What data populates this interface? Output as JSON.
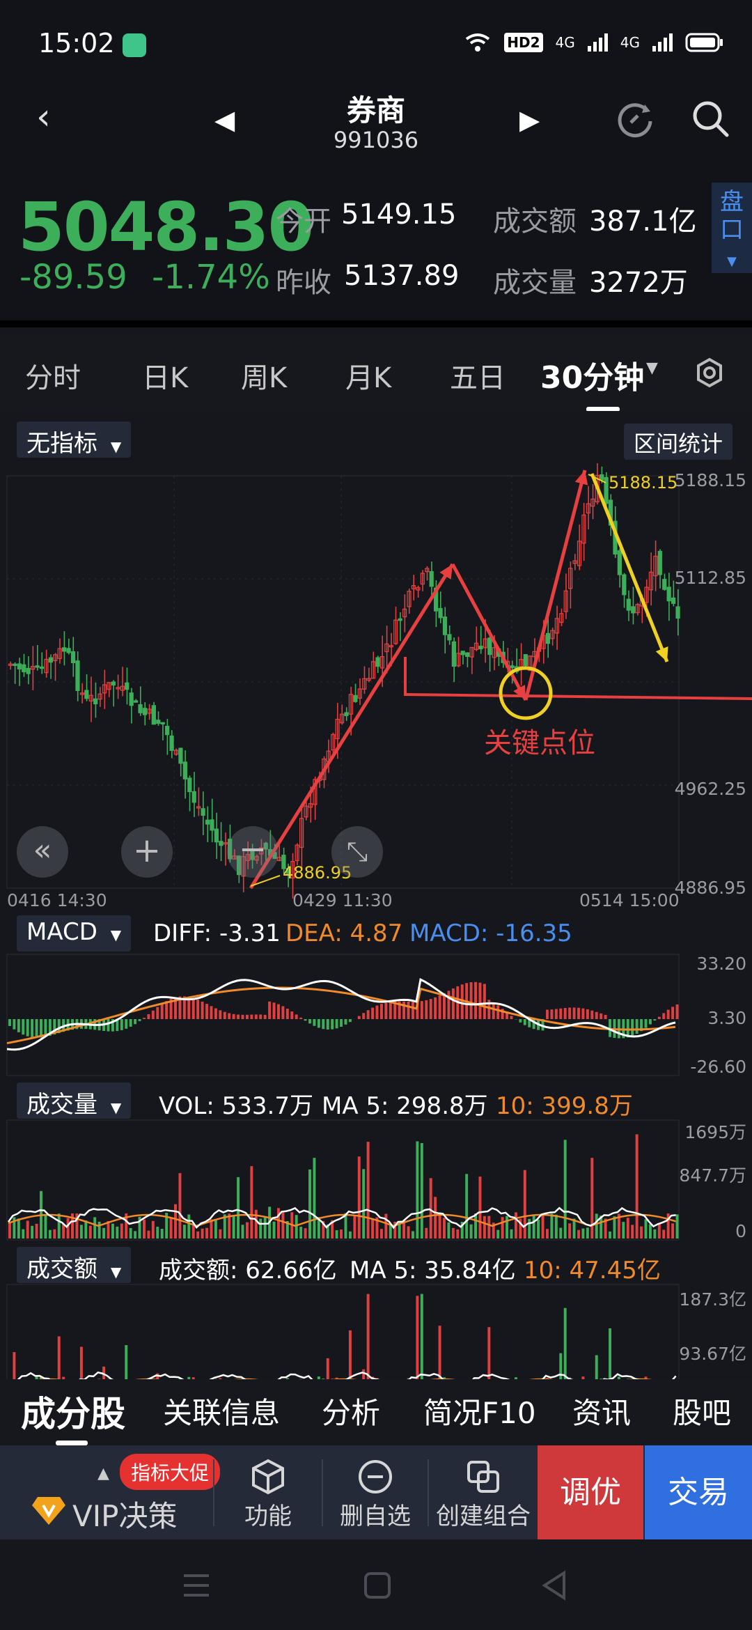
{
  "status": {
    "time": "15:02",
    "icons": [
      "wifi-icon",
      "hd-icon",
      "signal-4g-icon",
      "signal-4g-icon",
      "battery-icon"
    ],
    "hd_label": "HD2",
    "net1": "4G",
    "net2": "4G"
  },
  "header": {
    "title": "券商",
    "code": "991036"
  },
  "quote": {
    "price": "5048.30",
    "change": "-89.59",
    "change_pct": "-1.74%",
    "open_label": "今开",
    "open": "5149.15",
    "prev_label": "昨收",
    "prev": "5137.89",
    "amount_label": "成交额",
    "amount": "387.1亿",
    "volume_label": "成交量",
    "volume": "3272万",
    "pankou": "盘口"
  },
  "tabs": {
    "items": [
      "分时",
      "日K",
      "周K",
      "月K",
      "五日",
      "30分钟"
    ],
    "active": "30分钟"
  },
  "main_chart": {
    "indicator_chip": "无指标",
    "range_button": "区间统计",
    "y_labels": [
      "5188.15",
      "5112.85",
      "4962.25",
      "4886.95"
    ],
    "x_labels": [
      "0416  14:30",
      "0429  11:30",
      "0514  15:00"
    ],
    "high_label": "5188.15",
    "low_label": "4886.95",
    "annotation": "关键点位"
  },
  "macd": {
    "chip": "MACD",
    "diff": "DIFF: -3.31",
    "dea": "DEA: 4.87",
    "macd": "MACD: -16.35",
    "y_labels": [
      "33.20",
      "3.30",
      "-26.60"
    ]
  },
  "vol": {
    "chip": "成交量",
    "vol": "VOL: 533.7万",
    "ma5": "MA 5: 298.8万",
    "ma10": "10: 399.8万",
    "y_labels": [
      "1695万",
      "847.7万",
      "0"
    ]
  },
  "amt": {
    "chip": "成交额",
    "amt": "成交额: 62.66亿",
    "ma5": "MA 5: 35.84亿",
    "ma10": "10: 47.45亿",
    "y_labels": [
      "187.3亿",
      "93.67亿"
    ]
  },
  "bottom_tabs": {
    "items": [
      "成分股",
      "关联信息",
      "分析",
      "简况F10",
      "资讯",
      "股吧"
    ]
  },
  "actions": {
    "vip": "VIP决策",
    "promo": "指标大促",
    "func": "功能",
    "remove": "删自选",
    "combo": "创建组合",
    "tune": "调优",
    "trade": "交易"
  },
  "colors": {
    "up": "#e04040",
    "down": "#3dae5a",
    "accent": "#2f6fe0",
    "dea": "#f08a2a",
    "macd": "#4a8ef0",
    "annot": "#e84040",
    "highlight": "#f0d020"
  }
}
